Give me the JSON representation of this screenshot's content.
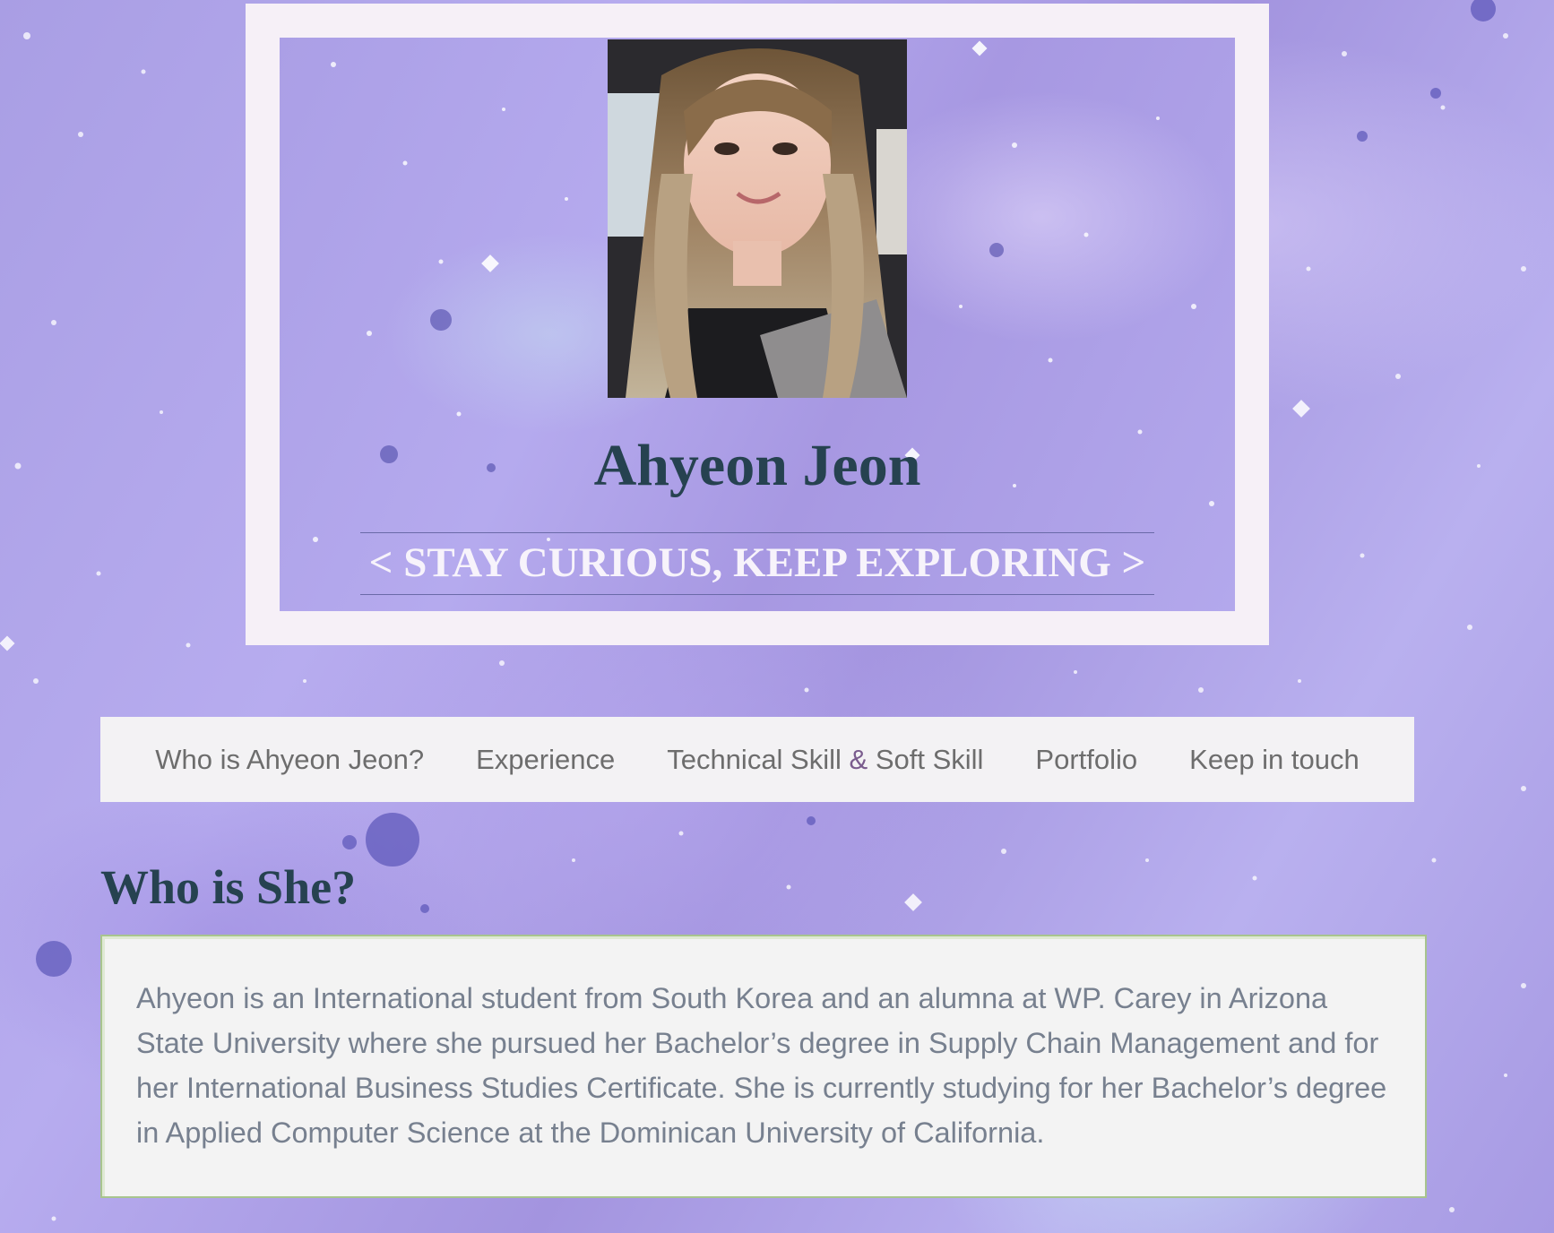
{
  "colors": {
    "card_background": "#f6f0f7",
    "heading_color": "#264250",
    "nav_background": "#f3f2f4",
    "nav_text": "#6d6d6d",
    "about_text": "#77808f",
    "about_border": "#a8c48e",
    "tagline_color": "#f7f3fb"
  },
  "header": {
    "name": "Ahyeon Jeon",
    "tagline": "< STAY CURIOUS, KEEP EXPLORING >"
  },
  "nav": {
    "items": [
      {
        "label": "Who is Ahyeon Jeon?"
      },
      {
        "label": "Experience"
      },
      {
        "label_part1": "Technical Skill ",
        "amp": "&",
        "label_part2": " Soft Skill"
      },
      {
        "label": "Portfolio"
      },
      {
        "label": "Keep in touch"
      }
    ]
  },
  "about": {
    "title": "Who is She?",
    "text": "Ahyeon is an International student from South Korea and an alumna at WP. Carey in Arizona State University where she pursued her Bachelor’s degree in Supply Chain Management and for her International Business Studies Certificate. She is currently studying for her Bachelor’s degree in Applied Computer Science at the Dominican University of California."
  }
}
